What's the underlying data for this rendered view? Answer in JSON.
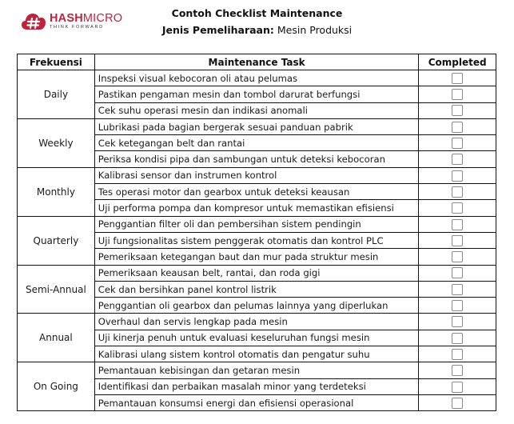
{
  "brand": {
    "name_bold": "HASH",
    "name_regular": "MICRO",
    "tagline": "THINK FORWARD",
    "color": "#c0223d"
  },
  "title": "Contoh Checklist Maintenance",
  "subtitle": {
    "label": "Jenis Pemeliharaan:",
    "value": "Mesin Produksi"
  },
  "table": {
    "headers": [
      "Frekuensi",
      "Maintenance Task",
      "Completed"
    ],
    "groups": [
      {
        "frequency": "Daily",
        "tasks": [
          {
            "task": "Inspeksi visual kebocoran oli atau pelumas",
            "completed": false
          },
          {
            "task": "Pastikan pengaman mesin dan tombol darurat berfungsi",
            "completed": false
          },
          {
            "task": "Cek suhu operasi mesin dan indikasi anomali",
            "completed": false
          }
        ]
      },
      {
        "frequency": "Weekly",
        "tasks": [
          {
            "task": "Lubrikasi pada bagian bergerak sesuai panduan pabrik",
            "completed": false
          },
          {
            "task": "Cek ketegangan belt dan rantai",
            "completed": false
          },
          {
            "task": "Periksa kondisi pipa dan sambungan untuk deteksi kebocoran",
            "completed": false
          }
        ]
      },
      {
        "frequency": "Monthly",
        "tasks": [
          {
            "task": "Kalibrasi sensor dan instrumen kontrol",
            "completed": false
          },
          {
            "task": "Tes operasi motor dan gearbox untuk deteksi keausan",
            "completed": false
          },
          {
            "task": "Uji performa pompa dan kompresor untuk memastikan efisiensi",
            "completed": false
          }
        ]
      },
      {
        "frequency": "Quarterly",
        "tasks": [
          {
            "task": "Penggantian filter oli dan pembersihan sistem pendingin",
            "completed": false
          },
          {
            "task": "Uji fungsionalitas sistem penggerak otomatis dan kontrol PLC",
            "completed": false
          },
          {
            "task": "Pemeriksaan ketegangan baut dan mur pada struktur mesin",
            "completed": false
          }
        ]
      },
      {
        "frequency": "Semi-Annual",
        "tasks": [
          {
            "task": "Pemeriksaan keausan belt, rantai, dan roda gigi",
            "completed": false
          },
          {
            "task": "Cek dan bersihkan panel kontrol listrik",
            "completed": false
          },
          {
            "task": "Penggantian oli gearbox dan pelumas lainnya yang diperlukan",
            "completed": false
          }
        ]
      },
      {
        "frequency": "Annual",
        "tasks": [
          {
            "task": "Overhaul dan servis lengkap pada mesin",
            "completed": false
          },
          {
            "task": "Uji kinerja penuh untuk evaluasi keseluruhan fungsi mesin",
            "completed": false
          },
          {
            "task": "Kalibrasi ulang sistem kontrol otomatis dan pengatur suhu",
            "completed": false
          }
        ]
      },
      {
        "frequency": "On Going",
        "tasks": [
          {
            "task": "Pemantauan kebisingan dan getaran mesin",
            "completed": false
          },
          {
            "task": "Identifikasi dan perbaikan masalah minor yang terdeteksi",
            "completed": false
          },
          {
            "task": "Pemantauan konsumsi energi dan efisiensi operasional",
            "completed": false
          }
        ]
      }
    ]
  }
}
